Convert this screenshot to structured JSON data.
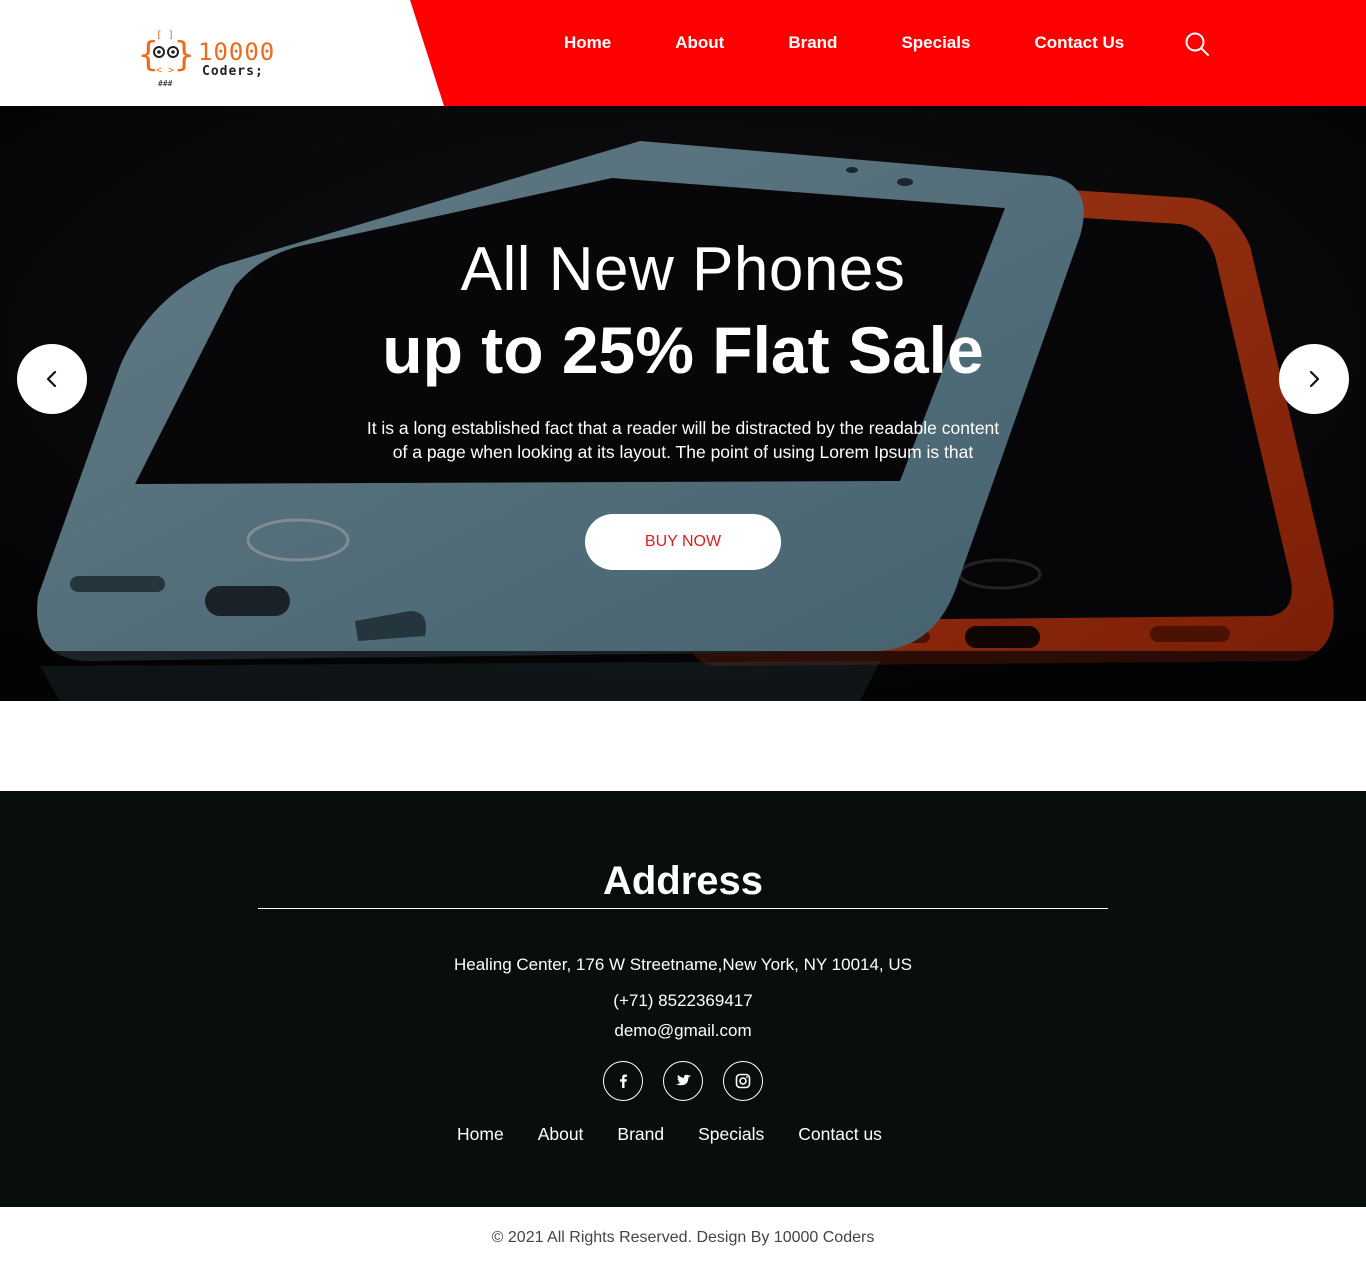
{
  "brand": {
    "logo_top": "10000",
    "logo_bottom": "Coders;",
    "accent_color": "#ff0000",
    "logo_color": "#ef6a1a"
  },
  "nav": {
    "items": [
      "Home",
      "About",
      "Brand",
      "Specials",
      "Contact Us"
    ],
    "search_icon": "search-icon"
  },
  "hero": {
    "title_line1": "All New Phones",
    "title_line2": "up to 25% Flat Sale",
    "text_line1": "It is a long established fact that a reader will be distracted by the readable content",
    "text_line2": "of a page when looking at its layout. The point of using Lorem Ipsum is that",
    "button_label": "BUY NOW",
    "prev_icon": "chevron-left-icon",
    "next_icon": "chevron-right-icon"
  },
  "footer": {
    "address_title": "Address",
    "street": "Healing Center, 176 W Streetname,New York, NY 10014, US",
    "phone": "(+71) 8522369417",
    "email": "demo@gmail.com",
    "socials": [
      "facebook-icon",
      "twitter-icon",
      "instagram-icon"
    ],
    "links": [
      "Home",
      "About",
      "Brand",
      "Specials",
      "Contact us"
    ],
    "background_color": "#080e0a"
  },
  "copyright": "© 2021 All Rights Reserved. Design By 10000 Coders"
}
